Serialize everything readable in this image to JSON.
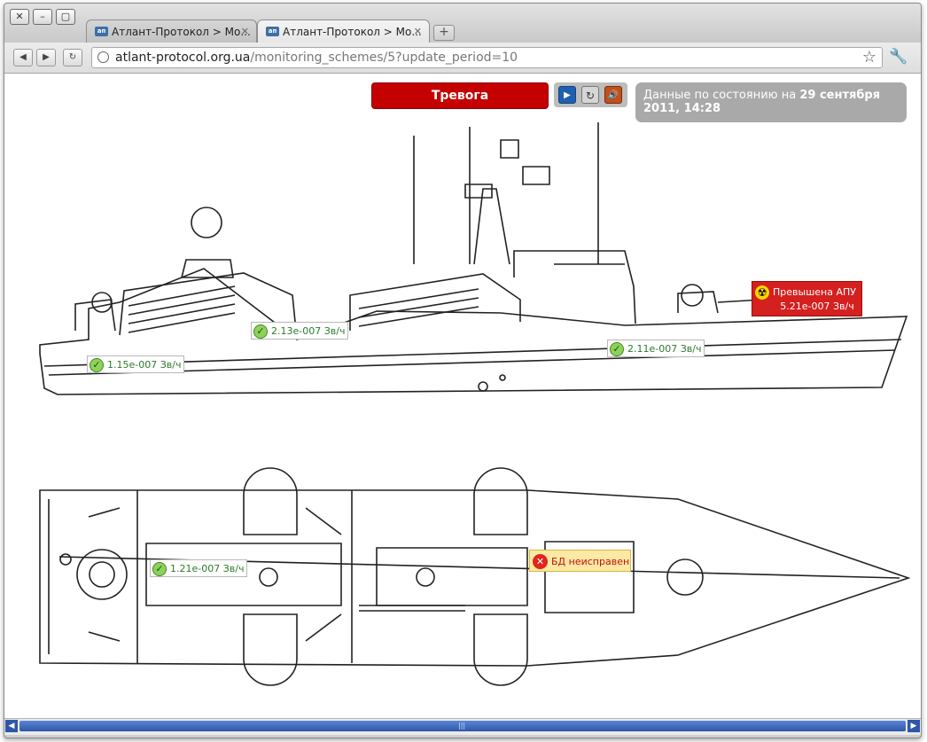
{
  "window": {
    "controls": [
      "✕",
      "–",
      "▢"
    ]
  },
  "tabs": [
    {
      "favicon": "ап",
      "title": "Атлант-Протокол > Мо...",
      "close": "✕"
    },
    {
      "favicon": "ап",
      "title": "Атлант-Протокол > Мо...",
      "close": "✕"
    }
  ],
  "new_tab": "+",
  "toolbar": {
    "back_icon": "back-icon",
    "forward_icon": "forward-icon",
    "reload_icon": "reload-icon",
    "url_host": "atlant-protocol.org.ua",
    "url_path": "/monitoring_schemes/5?update_period=10",
    "star_icon": "star-icon",
    "wrench_icon": "wrench-icon"
  },
  "status": {
    "alarm_label": "Тревога",
    "alarm_color": "#c50000",
    "date_prefix": "Данные по состоянию на ",
    "date_value": "29 сентября 2011, 14:28"
  },
  "controls": {
    "play_icon": "play-icon",
    "refresh_icon": "refresh-icon",
    "sound_icon": "sound-icon"
  },
  "sensors": [
    {
      "value": "1.15e-007 Зв/ч",
      "state": "ok"
    },
    {
      "value": "2.13e-007 Зв/ч",
      "state": "ok"
    },
    {
      "value": "2.11e-007 Зв/ч",
      "state": "ok"
    },
    {
      "value": "1.21e-007 Зв/ч",
      "state": "ok"
    }
  ],
  "alert_sensor": {
    "line1": "Превышена АПУ",
    "line2": "5.21e-007 Зв/ч",
    "icon": "radiation-icon",
    "color": "#d4201f"
  },
  "fault_sensor": {
    "label": "БД неисправен",
    "icon": "error-icon"
  },
  "scrollbar": {
    "grip": "|||"
  }
}
